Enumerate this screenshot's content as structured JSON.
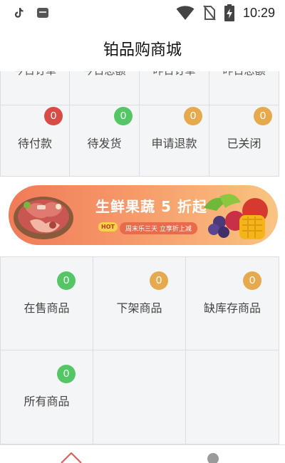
{
  "status_bar": {
    "time": "10:29",
    "icons": [
      "tiktok-icon",
      "app-notification-icon",
      "wifi-icon",
      "no-sim-icon",
      "battery-charging-icon"
    ]
  },
  "header": {
    "title": "铂品购商城"
  },
  "summary_row": {
    "labels": [
      "今日订单",
      "今日总额",
      "昨日订单",
      "昨日总额"
    ]
  },
  "order_status": [
    {
      "label": "待付款",
      "count": "0",
      "badge_color": "#d94b45"
    },
    {
      "label": "待发货",
      "count": "0",
      "badge_color": "#55c665"
    },
    {
      "label": "申请退款",
      "count": "0",
      "badge_color": "#e6a94d"
    },
    {
      "label": "已关闭",
      "count": "0",
      "badge_color": "#e6a94d"
    }
  ],
  "banner": {
    "title": "生鲜果蔬 5 折起",
    "hot": "HOT",
    "promo": "周末乐三天  立享折上减"
  },
  "goods": [
    {
      "label": "在售商品",
      "count": "0",
      "badge_color": "#55c665"
    },
    {
      "label": "下架商品",
      "count": "0",
      "badge_color": "#e6a94d"
    },
    {
      "label": "缺库存商品",
      "count": "0",
      "badge_color": "#e6a94d"
    },
    {
      "label": "所有商品",
      "count": "0",
      "badge_color": "#55c665"
    }
  ],
  "bottom_nav": {
    "icons": [
      "home-icon",
      "profile-icon"
    ]
  }
}
